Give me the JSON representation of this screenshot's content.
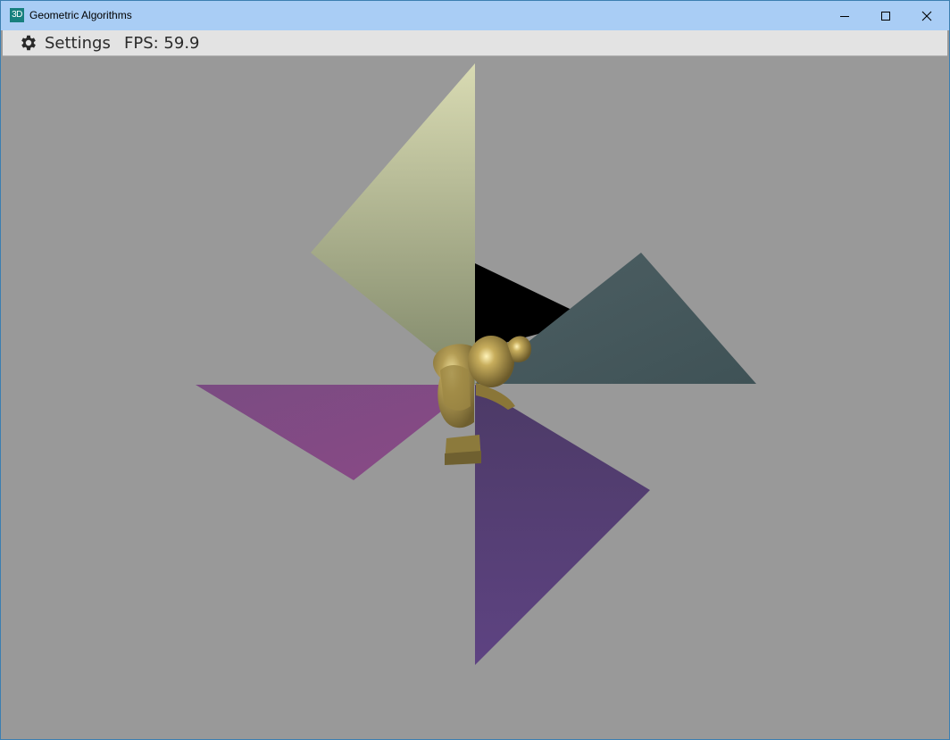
{
  "window": {
    "icon_text": "3D",
    "title": "Geometric Algorithms"
  },
  "menu": {
    "settings_label": "Settings",
    "fps_label": "FPS: 59.9"
  },
  "scene": {
    "background_color": "#999999",
    "blades": [
      {
        "name": "blade-top-yellow",
        "color_light": "#d9dbb3",
        "color_dark": "#7f8769"
      },
      {
        "name": "blade-right-teal",
        "color_light": "#4d5f63",
        "color_dark": "#3f5256"
      },
      {
        "name": "blade-left-magenta",
        "color_light": "#7a4b82",
        "color_dark": "#8a4a86"
      },
      {
        "name": "blade-bottom-violet",
        "color_light": "#4c3a66",
        "color_dark": "#5e4382"
      },
      {
        "name": "blade-shadow-black",
        "color_light": "#000000",
        "color_dark": "#000000"
      }
    ],
    "model": {
      "name": "gold-statue",
      "color_light": "#e8d78a",
      "color_dark": "#7a6a36"
    }
  }
}
